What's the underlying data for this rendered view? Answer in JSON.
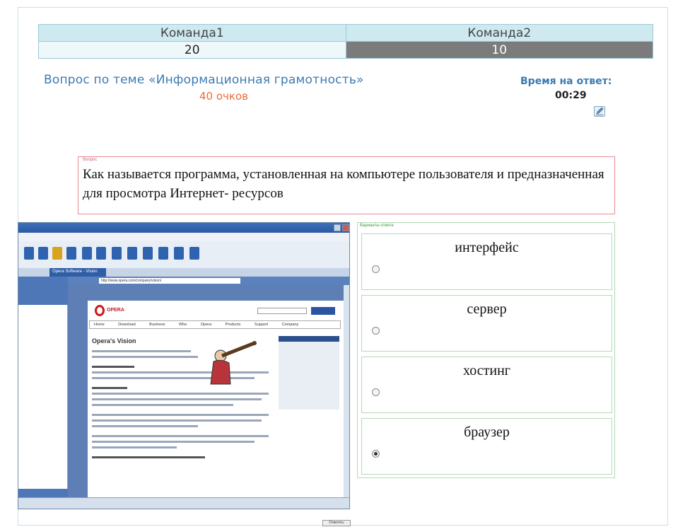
{
  "scoreboard": {
    "teams": [
      {
        "name": "Команда1",
        "score": "20"
      },
      {
        "name": "Команда2",
        "score": "10"
      }
    ]
  },
  "question_header": {
    "title": "Вопрос по теме «Информационная грамотность»",
    "points": "40 очков",
    "time_label": "Время на ответ:",
    "time_value": "00:29"
  },
  "question": {
    "tag": "Вопрос",
    "text": "Как называется программа, установленная на компьютере пользователя и предназначенная для просмотра Интернет- ресурсов"
  },
  "screenshot": {
    "tab_label": "Opera Software - Vision",
    "address": "http://www.opera.com/company/vision/",
    "logo_text": "OPERA",
    "nav": "Home Download Business Who Opera Products Support Company",
    "heading": "Opera's Vision"
  },
  "answers": {
    "tag": "Варианты ответа",
    "options": [
      {
        "label": "интерфейс",
        "selected": false
      },
      {
        "label": "сервер",
        "selected": false
      },
      {
        "label": "хостинг",
        "selected": false
      },
      {
        "label": "браузер",
        "selected": true
      }
    ]
  },
  "submit_label": "Ответить",
  "colors": {
    "header_blue": "#3b7ab1",
    "points_orange": "#ef6b37",
    "team2_score_bg": "#7b7b7b",
    "question_border": "#e58a95",
    "answers_border": "#b4d9b4"
  }
}
